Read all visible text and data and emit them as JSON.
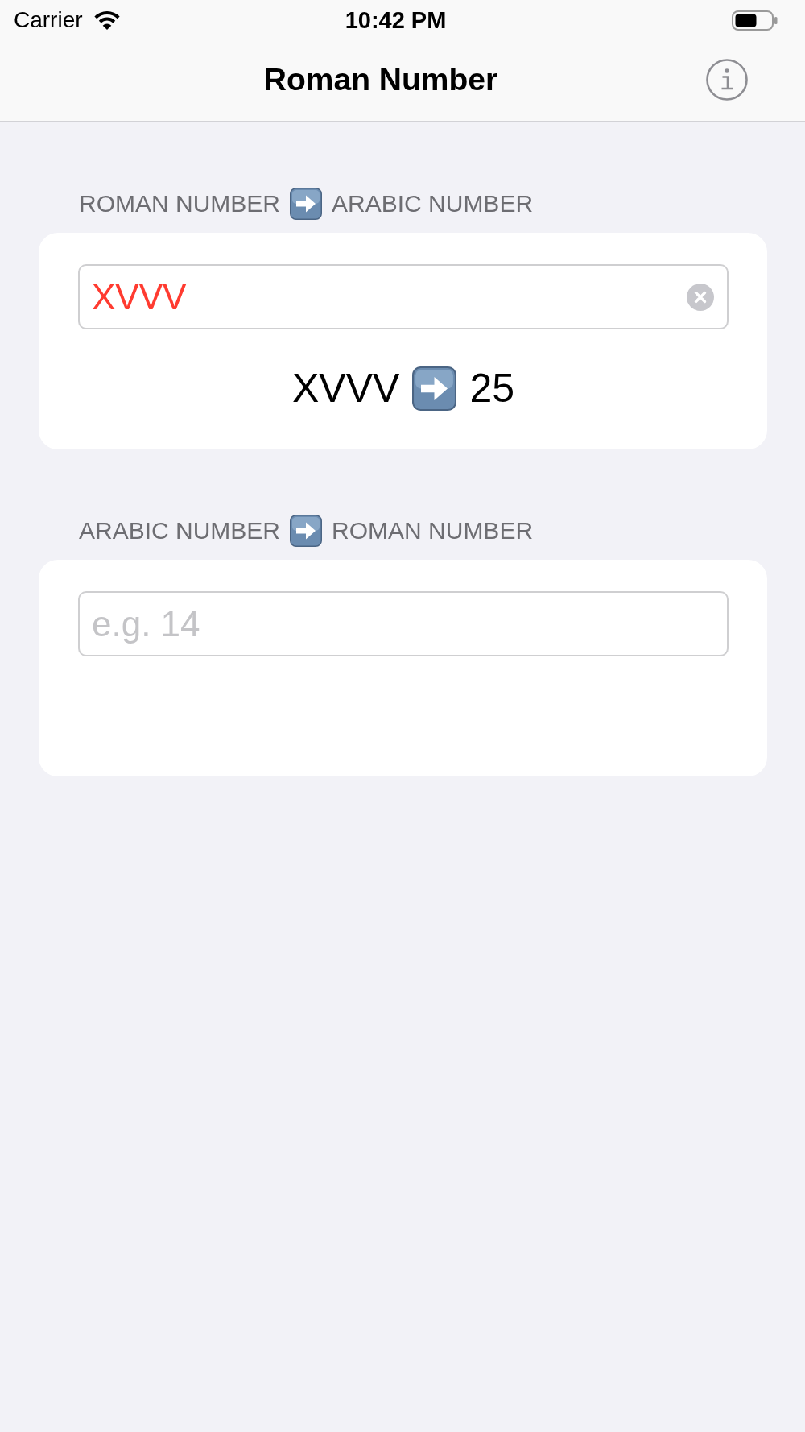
{
  "status_bar": {
    "carrier": "Carrier",
    "time": "10:42 PM"
  },
  "nav_bar": {
    "title": "Roman Number"
  },
  "sections": [
    {
      "header": {
        "from": "ROMAN NUMBER",
        "to": "ARABIC NUMBER"
      },
      "field": {
        "value": "XVVV",
        "invalid": true,
        "clear_button": true
      },
      "result": {
        "input": "XVVV",
        "output": "25"
      }
    },
    {
      "header": {
        "from": "ARABIC NUMBER",
        "to": "ROMAN NUMBER"
      },
      "field": {
        "placeholder": "e.g. 14"
      }
    }
  ]
}
